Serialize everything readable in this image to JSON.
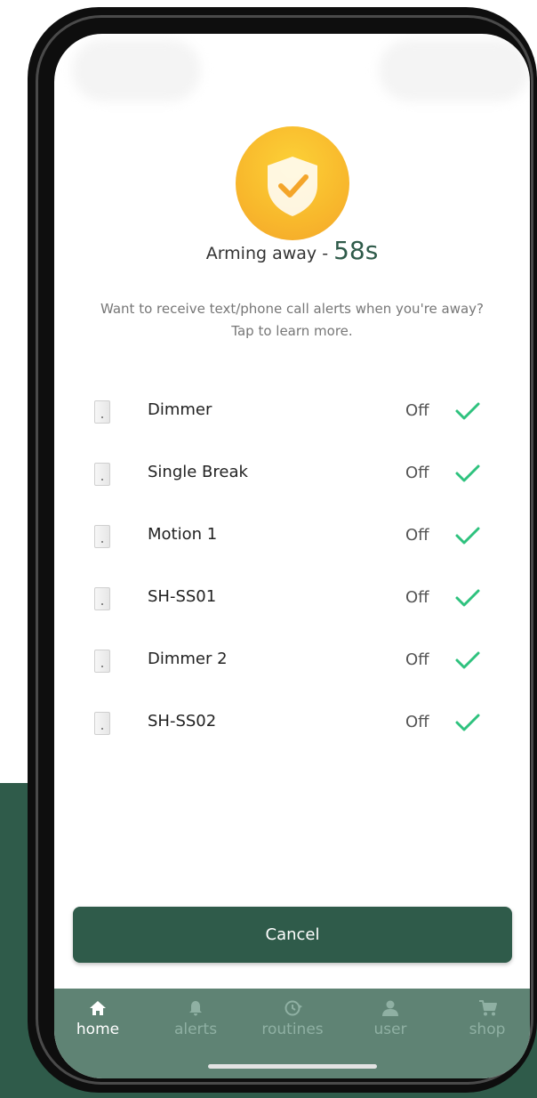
{
  "arming": {
    "label": "Arming away -",
    "countdown": "58s"
  },
  "info": {
    "line1": "Want to receive text/phone call alerts when you're away?",
    "line2": "Tap to learn more."
  },
  "devices": [
    {
      "name": "Dimmer",
      "status": "Off"
    },
    {
      "name": "Single Break",
      "status": "Off"
    },
    {
      "name": "Motion 1",
      "status": "Off"
    },
    {
      "name": "SH-SS01",
      "status": "Off"
    },
    {
      "name": "Dimmer 2",
      "status": "Off"
    },
    {
      "name": "SH-SS02",
      "status": "Off"
    }
  ],
  "cancel_label": "Cancel",
  "tabs": [
    {
      "label": "home",
      "icon": "home-icon",
      "active": true
    },
    {
      "label": "alerts",
      "icon": "bell-icon",
      "active": false
    },
    {
      "label": "routines",
      "icon": "clock-icon",
      "active": false
    },
    {
      "label": "user",
      "icon": "user-icon",
      "active": false
    },
    {
      "label": "shop",
      "icon": "cart-icon",
      "active": false
    }
  ],
  "colors": {
    "brand_green": "#2f5b4a",
    "tab_bar": "#5f8374",
    "check_green": "#2ec27e",
    "shield_yellow": "#f8b82c"
  }
}
